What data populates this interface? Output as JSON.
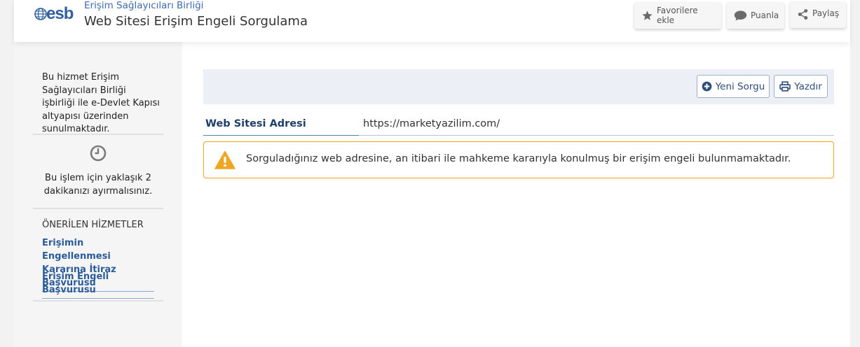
{
  "header": {
    "org_name": "Erişim Sağlayıcıları Birliği",
    "logo_text": "esb",
    "title": "Web Sitesi Erişim Engeli Sorgulama",
    "buttons": {
      "favorite": "Favorilere ekle",
      "rate": "Puanla",
      "share": "Paylaş"
    }
  },
  "sidebar": {
    "intro": "Bu hizmet Erişim Sağlayıcıları Birliği işbirliği ile e-Devlet Kapısı altyapısı üzerinden sunulmaktadır.",
    "time_note": "Bu işlem için yaklaşık 2 dakikanızı ayırmalısınız.",
    "recommended_title": "ÖNERİLEN HİZMETLER",
    "recommended": [
      {
        "label": "Erişimin Engellenmesi Kararına İtiraz Başvurusu"
      },
      {
        "label": "Erişim Engeli Başvurusu"
      }
    ]
  },
  "main": {
    "toolbar": {
      "new_query": "Yeni Sorgu",
      "print": "Yazdır"
    },
    "field": {
      "label": "Web Sitesi Adresi",
      "value": "https://marketyazilim.com/"
    },
    "alert": {
      "message": "Sorguladığınız web adresine, an itibari ile mahkeme kararıyla konulmuş bir erişim engeli bulunmamaktadır."
    }
  },
  "colors": {
    "brand": "#2f5f9e",
    "link": "#2b5c9a",
    "warning": "#f0a623",
    "toolbar_bg": "#ecf0f6"
  },
  "icons": {
    "favorite": "star-icon",
    "rate": "speech-bubble-icon",
    "share": "share-icon",
    "new_query": "plus-circle-icon",
    "print": "printer-icon",
    "time": "clock-icon",
    "alert": "warning-triangle-icon"
  }
}
